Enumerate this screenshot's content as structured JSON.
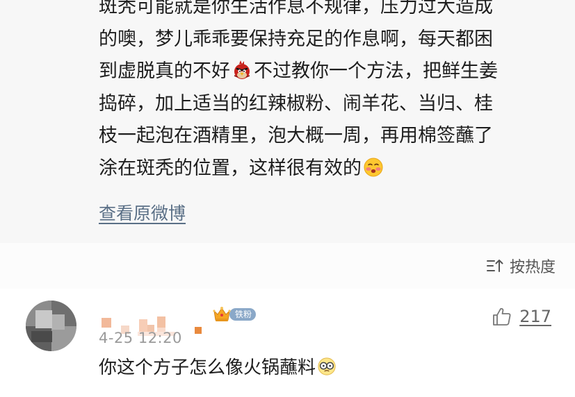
{
  "post": {
    "line1": "斑秃可能就是你生活作息不规律，压力过大造成",
    "line2": "的噢，梦儿乖乖要保持充足的作息啊，每天都困",
    "line3_a": "到虚脱真的不好",
    "line3_emoji": "angry-bird-emoji",
    "line3_b": "不过教你一个方法，把鲜生姜",
    "line4": "捣碎，加上适当的红辣椒粉、闹羊花、当归、桂",
    "line5": "枝一起泡在酒精里，泡大概一周，再用棉签蘸了",
    "line6_a": "涂在斑秃的位置，这样很有效的",
    "line6_emoji": "blushing-face-emoji",
    "view_original": "查看原微博"
  },
  "sort": {
    "label": "按热度",
    "icon": "sort-icon"
  },
  "comment": {
    "fan_badge": "铁粉",
    "timestamp": "4-25 12:20",
    "text": "你这个方子怎么像火锅蘸料",
    "text_emoji": "glasses-face-emoji",
    "likes": "217",
    "like_icon": "thumbs-up-icon"
  },
  "colors": {
    "post_background": "#f7f7f7",
    "link": "#5a6f86",
    "badge": "#8aa8c8",
    "muted_text": "#9a9a9a"
  }
}
